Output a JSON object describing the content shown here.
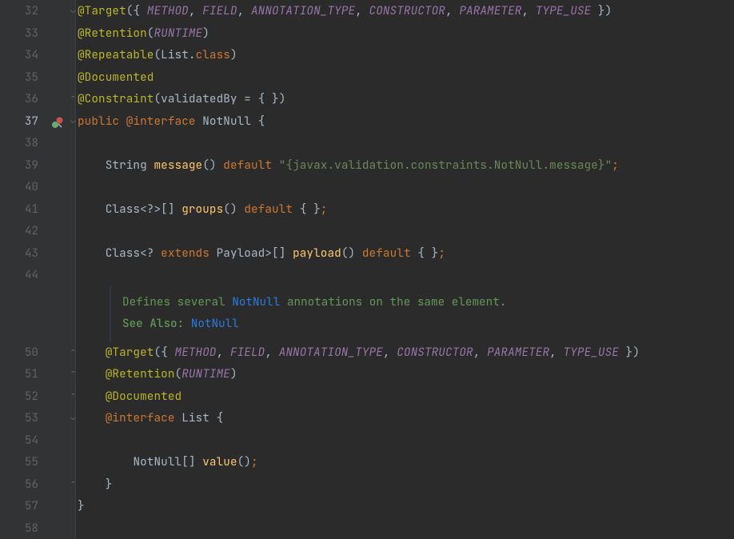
{
  "lines": {
    "start": 32,
    "end": 58
  },
  "code": {
    "l32": {
      "ann": "@Target",
      "open": "({ ",
      "c1": "METHOD",
      "c2": "FIELD",
      "c3": "ANNOTATION_TYPE",
      "c4": "CONSTRUCTOR",
      "c5": "PARAMETER",
      "c6": "TYPE_USE",
      "close": " })"
    },
    "l33": {
      "ann": "@Retention",
      "open": "(",
      "v": "RUNTIME",
      "close": ")"
    },
    "l34": {
      "ann": "@Repeatable",
      "open": "(",
      "cls": "List",
      "dot": ".",
      "kw": "class",
      "close": ")"
    },
    "l35": {
      "ann": "@Documented"
    },
    "l36": {
      "ann": "@Constraint",
      "open": "(",
      "attr": "validatedBy",
      "eq": " = { })"
    },
    "l37": {
      "mod": "public",
      "at": "@",
      "intf": "interface",
      "name": "NotNull",
      "brace": " {"
    },
    "l39": {
      "type": "String",
      "name": "message",
      "parens": "()",
      "kw": "default",
      "str": "\"{javax.validation.constraints.NotNull.message}\"",
      "semi": ";"
    },
    "l41": {
      "type": "Class",
      "generic": "<?>[]",
      "name": "groups",
      "parens": "()",
      "kw": "default",
      "body": " { }",
      "semi": ";"
    },
    "l43": {
      "type": "Class",
      "lt": "<?",
      "ext": "extends",
      "payload": "Payload",
      "gt": ">[]",
      "name": "payload",
      "parens": "()",
      "kw": "default",
      "body": " { }",
      "semi": ";"
    },
    "doc": {
      "line1a": "Defines several ",
      "link1": "NotNull",
      "line1b": " annotations on the same element.",
      "line2a": "See Also: ",
      "link2": "NotNull"
    },
    "l50": {
      "ann": "@Target",
      "open": "({ ",
      "c1": "METHOD",
      "c2": "FIELD",
      "c3": "ANNOTATION_TYPE",
      "c4": "CONSTRUCTOR",
      "c5": "PARAMETER",
      "c6": "TYPE_USE",
      "close": " })"
    },
    "l51": {
      "ann": "@Retention",
      "open": "(",
      "v": "RUNTIME",
      "close": ")"
    },
    "l52": {
      "ann": "@Documented"
    },
    "l53": {
      "at": "@",
      "intf": "interface",
      "name": "List",
      "brace": " {"
    },
    "l55": {
      "type": "NotNull",
      "arr": "[]",
      "name": "value",
      "parens": "()",
      "semi": ";"
    },
    "l56": {
      "brace": "}"
    },
    "l57": {
      "brace": "}"
    }
  },
  "colors": {
    "bg": "#2b2b2b",
    "gutter": "#313335",
    "keyword": "#cc7832",
    "annotation": "#bbb529",
    "static": "#9876aa",
    "string": "#6a8759",
    "method": "#ffc66d",
    "doc": "#629755",
    "link": "#287bde"
  },
  "icons": {
    "impl_marker_line": 37
  }
}
